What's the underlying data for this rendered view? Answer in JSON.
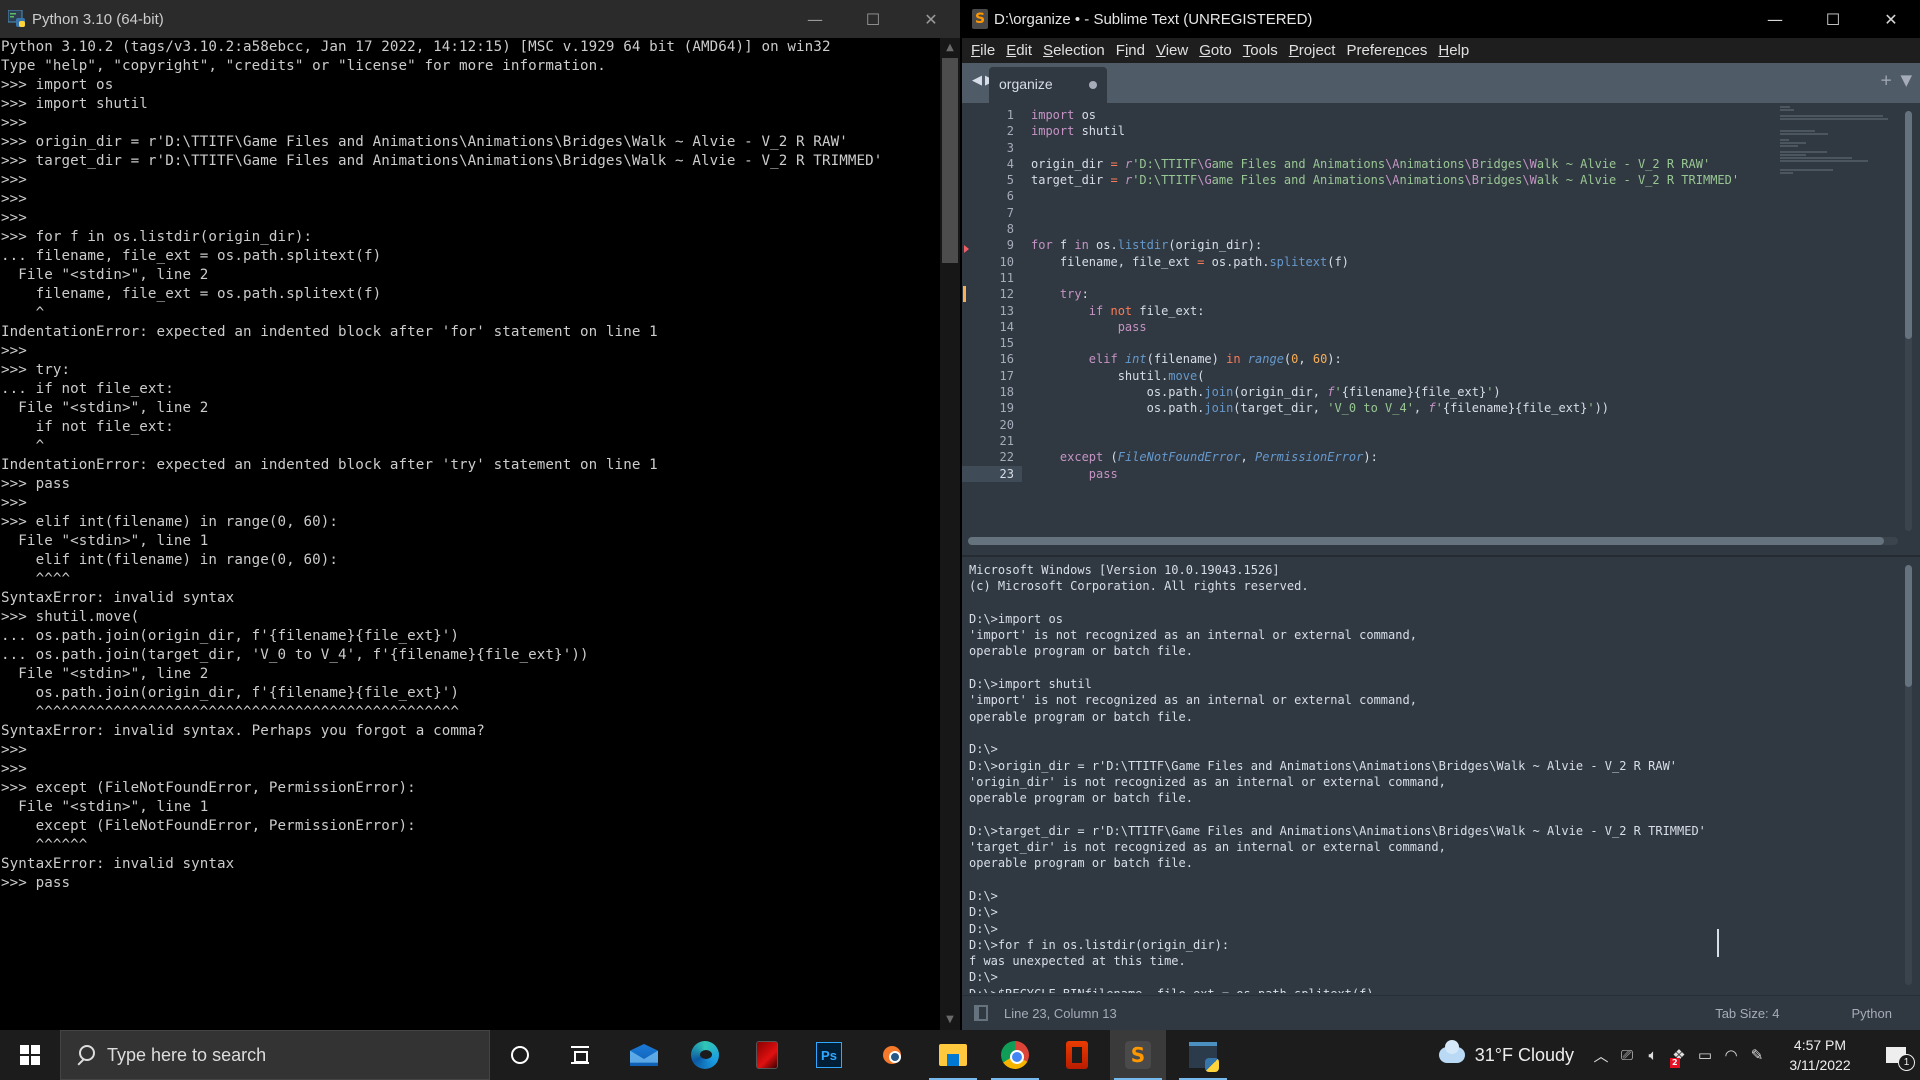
{
  "python_window": {
    "title": "Python 3.10 (64-bit)",
    "controls": {
      "minimize": "—",
      "maximize": "☐",
      "close": "✕"
    },
    "console_lines": [
      "Python 3.10.2 (tags/v3.10.2:a58ebcc, Jan 17 2022, 14:12:15) [MSC v.1929 64 bit (AMD64)] on win32",
      "Type \"help\", \"copyright\", \"credits\" or \"license\" for more information.",
      ">>> import os",
      ">>> import shutil",
      ">>>",
      ">>> origin_dir = r'D:\\TTITF\\Game Files and Animations\\Animations\\Bridges\\Walk ~ Alvie - V_2 R RAW'",
      ">>> target_dir = r'D:\\TTITF\\Game Files and Animations\\Animations\\Bridges\\Walk ~ Alvie - V_2 R TRIMMED'",
      ">>>",
      ">>>",
      ">>>",
      ">>> for f in os.listdir(origin_dir):",
      "... filename, file_ext = os.path.splitext(f)",
      "  File \"<stdin>\", line 2",
      "    filename, file_ext = os.path.splitext(f)",
      "    ^",
      "IndentationError: expected an indented block after 'for' statement on line 1",
      ">>>",
      ">>> try:",
      "... if not file_ext:",
      "  File \"<stdin>\", line 2",
      "    if not file_ext:",
      "    ^",
      "IndentationError: expected an indented block after 'try' statement on line 1",
      ">>> pass",
      ">>>",
      ">>> elif int(filename) in range(0, 60):",
      "  File \"<stdin>\", line 1",
      "    elif int(filename) in range(0, 60):",
      "    ^^^^",
      "SyntaxError: invalid syntax",
      ">>> shutil.move(",
      "... os.path.join(origin_dir, f'{filename}{file_ext}')",
      "... os.path.join(target_dir, 'V_0 to V_4', f'{filename}{file_ext}'))",
      "  File \"<stdin>\", line 2",
      "    os.path.join(origin_dir, f'{filename}{file_ext}')",
      "    ^^^^^^^^^^^^^^^^^^^^^^^^^^^^^^^^^^^^^^^^^^^^^^^^^",
      "SyntaxError: invalid syntax. Perhaps you forgot a comma?",
      ">>>",
      ">>>",
      ">>> except (FileNotFoundError, PermissionError):",
      "  File \"<stdin>\", line 1",
      "    except (FileNotFoundError, PermissionError):",
      "    ^^^^^^",
      "SyntaxError: invalid syntax",
      ">>> pass"
    ]
  },
  "sublime_window": {
    "title": "D:\\organize • - Sublime Text (UNREGISTERED)",
    "controls": {
      "minimize": "—",
      "maximize": "☐",
      "close": "✕"
    },
    "menu": [
      {
        "accel": "F",
        "rest": "ile"
      },
      {
        "accel": "E",
        "rest": "dit"
      },
      {
        "accel": "S",
        "rest": "election"
      },
      {
        "pre": "F",
        "accel": "i",
        "rest": "nd"
      },
      {
        "accel": "V",
        "rest": "iew"
      },
      {
        "accel": "G",
        "rest": "oto"
      },
      {
        "accel": "T",
        "rest": "ools"
      },
      {
        "accel": "P",
        "rest": "roject"
      },
      {
        "pre": "Prefere",
        "accel": "n",
        "rest": "ces"
      },
      {
        "accel": "H",
        "rest": "elp"
      }
    ],
    "tab": {
      "label": "organize",
      "dirty": true
    },
    "editor": {
      "current_line": 23,
      "lines": [
        [
          {
            "t": "import",
            "c": "kw"
          },
          {
            "t": " os"
          }
        ],
        [
          {
            "t": "import",
            "c": "kw"
          },
          {
            "t": " shutil"
          }
        ],
        [],
        [
          {
            "t": "origin_dir "
          },
          {
            "t": "=",
            "c": "op"
          },
          {
            "t": " "
          },
          {
            "t": "r",
            "c": "pf"
          },
          {
            "t": "'D:\\TTITF",
            "c": "str"
          },
          {
            "t": "\\G",
            "c": "esc"
          },
          {
            "t": "ame Files and Animations",
            "c": "str"
          },
          {
            "t": "\\A",
            "c": "esc"
          },
          {
            "t": "nimations",
            "c": "str"
          },
          {
            "t": "\\B",
            "c": "esc"
          },
          {
            "t": "ridges",
            "c": "str"
          },
          {
            "t": "\\W",
            "c": "esc"
          },
          {
            "t": "alk ~ Alvie - V_2 R RAW'",
            "c": "str"
          }
        ],
        [
          {
            "t": "target_dir "
          },
          {
            "t": "=",
            "c": "op"
          },
          {
            "t": " "
          },
          {
            "t": "r",
            "c": "pf"
          },
          {
            "t": "'D:\\TTITF",
            "c": "str"
          },
          {
            "t": "\\G",
            "c": "esc"
          },
          {
            "t": "ame Files and Animations",
            "c": "str"
          },
          {
            "t": "\\A",
            "c": "esc"
          },
          {
            "t": "nimations",
            "c": "str"
          },
          {
            "t": "\\B",
            "c": "esc"
          },
          {
            "t": "ridges",
            "c": "str"
          },
          {
            "t": "\\W",
            "c": "esc"
          },
          {
            "t": "alk ~ Alvie - V_2 R TRIMMED'",
            "c": "str"
          }
        ],
        [],
        [],
        [],
        [
          {
            "t": "for",
            "c": "kw"
          },
          {
            "t": " f "
          },
          {
            "t": "in",
            "c": "kw"
          },
          {
            "t": " os."
          },
          {
            "t": "listdir",
            "c": "fn"
          },
          {
            "t": "(origin_dir):"
          }
        ],
        [
          {
            "t": "    filename, file_ext "
          },
          {
            "t": "=",
            "c": "op"
          },
          {
            "t": " os.path."
          },
          {
            "t": "splitext",
            "c": "fn"
          },
          {
            "t": "(f)"
          }
        ],
        [],
        [
          {
            "t": "    "
          },
          {
            "t": "try",
            "c": "kw"
          },
          {
            "t": ":"
          }
        ],
        [
          {
            "t": "        "
          },
          {
            "t": "if",
            "c": "kw"
          },
          {
            "t": " "
          },
          {
            "t": "not",
            "c": "op"
          },
          {
            "t": " file_ext:"
          }
        ],
        [
          {
            "t": "            "
          },
          {
            "t": "pass",
            "c": "kw"
          }
        ],
        [],
        [
          {
            "t": "        "
          },
          {
            "t": "elif",
            "c": "kw"
          },
          {
            "t": " "
          },
          {
            "t": "int",
            "c": "it"
          },
          {
            "t": "(filename) "
          },
          {
            "t": "in",
            "c": "op"
          },
          {
            "t": " "
          },
          {
            "t": "range",
            "c": "it"
          },
          {
            "t": "("
          },
          {
            "t": "0",
            "c": "num"
          },
          {
            "t": ", "
          },
          {
            "t": "60",
            "c": "num"
          },
          {
            "t": "):"
          }
        ],
        [
          {
            "t": "            shutil."
          },
          {
            "t": "move",
            "c": "fn"
          },
          {
            "t": "("
          }
        ],
        [
          {
            "t": "                os.path."
          },
          {
            "t": "join",
            "c": "fn"
          },
          {
            "t": "(origin_dir, "
          },
          {
            "t": "f",
            "c": "pf"
          },
          {
            "t": "'",
            "c": "str"
          },
          {
            "t": "{filename}{file_ext}"
          },
          {
            "t": "'",
            "c": "str"
          },
          {
            "t": ")"
          }
        ],
        [
          {
            "t": "                os.path."
          },
          {
            "t": "join",
            "c": "fn"
          },
          {
            "t": "(target_dir, "
          },
          {
            "t": "'V_0 to V_4'",
            "c": "str"
          },
          {
            "t": ", "
          },
          {
            "t": "f",
            "c": "pf"
          },
          {
            "t": "'",
            "c": "str"
          },
          {
            "t": "{filename}{file_ext}"
          },
          {
            "t": "'",
            "c": "str"
          },
          {
            "t": "))"
          }
        ],
        [],
        [],
        [
          {
            "t": "    "
          },
          {
            "t": "except",
            "c": "kw"
          },
          {
            "t": " ("
          },
          {
            "t": "FileNotFoundError",
            "c": "it"
          },
          {
            "t": ", "
          },
          {
            "t": "PermissionError",
            "c": "it"
          },
          {
            "t": "):"
          }
        ],
        [
          {
            "t": "        "
          },
          {
            "t": "pass",
            "c": "kw"
          }
        ]
      ]
    },
    "output_panel_lines": [
      "Microsoft Windows [Version 10.0.19043.1526]",
      "(c) Microsoft Corporation. All rights reserved.",
      "",
      "D:\\>import os",
      "'import' is not recognized as an internal or external command,",
      "operable program or batch file.",
      "",
      "D:\\>import shutil",
      "'import' is not recognized as an internal or external command,",
      "operable program or batch file.",
      "",
      "D:\\>",
      "D:\\>origin_dir = r'D:\\TTITF\\Game Files and Animations\\Animations\\Bridges\\Walk ~ Alvie - V_2 R RAW'",
      "'origin_dir' is not recognized as an internal or external command,",
      "operable program or batch file.",
      "",
      "D:\\>target_dir = r'D:\\TTITF\\Game Files and Animations\\Animations\\Bridges\\Walk ~ Alvie - V_2 R TRIMMED'",
      "'target_dir' is not recognized as an internal or external command,",
      "operable program or batch file.",
      "",
      "D:\\>",
      "D:\\>",
      "D:\\>",
      "D:\\>for f in os.listdir(origin_dir):",
      "f was unexpected at this time.",
      "D:\\>",
      "D:\\>$RECYCLE.BINfilename, file_ext = os.path.splitext(f)"
    ],
    "status": {
      "position": "Line 23, Column 13",
      "tab_size": "Tab Size: 4",
      "syntax": "Python"
    }
  },
  "taskbar": {
    "search_placeholder": "Type here to search",
    "apps": [
      {
        "name": "cortana",
        "active": false
      },
      {
        "name": "task-view",
        "active": false
      },
      {
        "name": "mail",
        "active": false
      },
      {
        "name": "edge",
        "active": false
      },
      {
        "name": "red-app",
        "active": false
      },
      {
        "name": "photoshop",
        "label": "Ps",
        "active": false
      },
      {
        "name": "blender",
        "active": false
      },
      {
        "name": "file-explorer",
        "active": false,
        "open": true
      },
      {
        "name": "chrome",
        "active": false,
        "open": true
      },
      {
        "name": "office",
        "active": false
      },
      {
        "name": "sublime-text",
        "label": "S",
        "active": true,
        "open": true
      },
      {
        "name": "python",
        "active": false,
        "open": true
      }
    ],
    "weather": "31°F  Cloudy",
    "tray": {
      "chevron": "^",
      "dropbox_badge": "2"
    },
    "clock": {
      "time": "4:57 PM",
      "date": "3/11/2022"
    },
    "notification_count": "1"
  }
}
